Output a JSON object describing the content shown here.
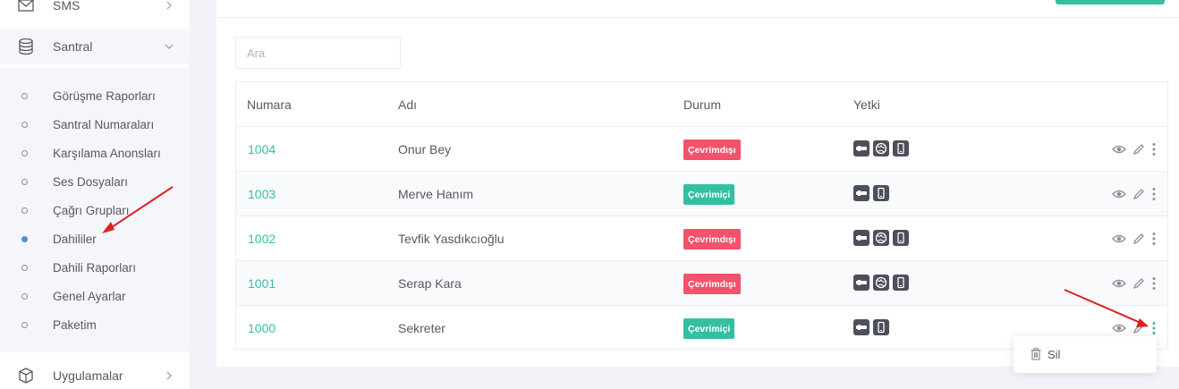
{
  "sidebar": {
    "sms_label": "SMS",
    "santral_label": "Santral",
    "submenu": [
      {
        "label": "Görüşme Raporları",
        "active": false
      },
      {
        "label": "Santral Numaraları",
        "active": false
      },
      {
        "label": "Karşılama Anonsları",
        "active": false
      },
      {
        "label": "Ses Dosyaları",
        "active": false
      },
      {
        "label": "Çağrı Grupları",
        "active": false
      },
      {
        "label": "Dahililer",
        "active": true
      },
      {
        "label": "Dahili Raporları",
        "active": false
      },
      {
        "label": "Genel Ayarlar",
        "active": false
      },
      {
        "label": "Paketim",
        "active": false
      }
    ],
    "uygulamalar_label": "Uygulamalar"
  },
  "search": {
    "placeholder": "Ara",
    "value": ""
  },
  "table": {
    "headers": {
      "numara": "Numara",
      "adi": "Adı",
      "durum": "Durum",
      "yetki": "Yetki"
    },
    "rows": [
      {
        "numara": "1004",
        "adi": "Onur Bey",
        "durum": "Çevrimdışı",
        "online": false,
        "yetki": [
          "extension-icon",
          "globe-icon",
          "mobile-icon"
        ]
      },
      {
        "numara": "1003",
        "adi": "Merve Hanım",
        "durum": "Çevrimiçi",
        "online": true,
        "yetki": [
          "extension-icon",
          "mobile-icon"
        ]
      },
      {
        "numara": "1002",
        "adi": "Tevfik Yasdıkcıoğlu",
        "durum": "Çevrimdışı",
        "online": false,
        "yetki": [
          "extension-icon",
          "globe-icon",
          "mobile-icon"
        ]
      },
      {
        "numara": "1001",
        "adi": "Serap Kara",
        "durum": "Çevrimdışı",
        "online": false,
        "yetki": [
          "extension-icon",
          "globe-icon",
          "mobile-icon"
        ]
      },
      {
        "numara": "1000",
        "adi": "Sekreter",
        "durum": "Çevrimiçi",
        "online": true,
        "yetki": [
          "extension-icon",
          "mobile-icon"
        ]
      }
    ]
  },
  "dropdown": {
    "delete_label": "Sil"
  },
  "colors": {
    "accent": "#34bfa3",
    "offline": "#f4516c",
    "online": "#34bfa3",
    "annotation_arrow": "#e02020",
    "active_dot": "#4a90e2"
  }
}
